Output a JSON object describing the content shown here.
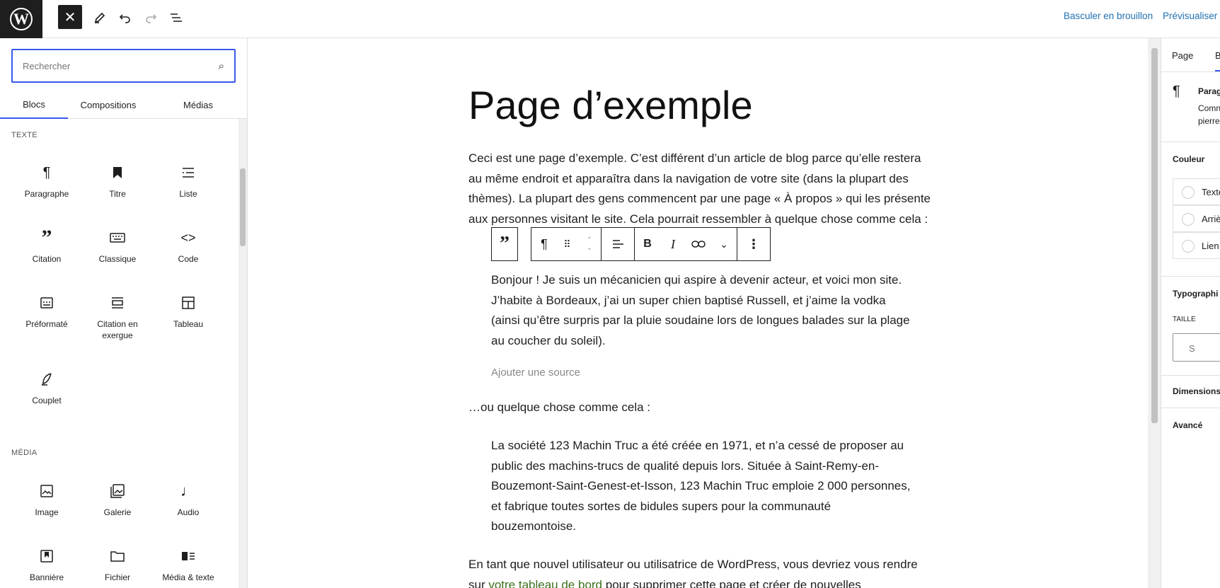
{
  "topbar": {
    "logo": "W",
    "right_links": [
      "Basculer en brouillon",
      "Prévisualiser"
    ]
  },
  "inserter": {
    "search_placeholder": "Rechercher",
    "tabs": [
      "Blocs",
      "Compositions",
      "Médias"
    ],
    "categories": {
      "text": "TEXTE",
      "media": "MÉDIA"
    },
    "text_blocks": [
      {
        "label": "Paragraphe",
        "icon": "paragraph-icon"
      },
      {
        "label": "Titre",
        "icon": "heading-icon"
      },
      {
        "label": "Liste",
        "icon": "list-icon"
      },
      {
        "label": "Citation",
        "icon": "quote-icon"
      },
      {
        "label": "Classique",
        "icon": "keyboard-icon"
      },
      {
        "label": "Code",
        "icon": "code-icon"
      },
      {
        "label": "Préformaté",
        "icon": "preformatted-icon"
      },
      {
        "label": "Citation en exergue",
        "icon": "pullquote-icon"
      },
      {
        "label": "Tableau",
        "icon": "table-icon"
      },
      {
        "label": "Couplet",
        "icon": "verse-icon"
      }
    ],
    "media_blocks": [
      {
        "label": "Image",
        "icon": "image-icon"
      },
      {
        "label": "Galerie",
        "icon": "gallery-icon"
      },
      {
        "label": "Audio",
        "icon": "audio-icon"
      },
      {
        "label": "Bannière",
        "icon": "cover-icon"
      },
      {
        "label": "Fichier",
        "icon": "file-icon"
      },
      {
        "label": "Média & texte",
        "icon": "media-text-icon"
      }
    ]
  },
  "document": {
    "title": "Page d’exemple",
    "intro": "Ceci est une page d’exemple. C’est différent d’un article de blog parce qu’elle restera au même endroit et apparaîtra dans la navigation de votre site (dans la plupart des thèmes). La plupart des gens commencent par une page « À propos » qui les présente aux personnes visitant le site. Cela pourrait ressembler à quelque chose comme cela :",
    "quote1": "Bonjour ! Je suis un mécanicien qui aspire à devenir acteur, et voici mon site. J’habite à Bordeaux, j’ai un super chien baptisé Russell, et j’aime la vodka (ainsi qu’être surpris par la pluie soudaine lors de longues balades sur la plage au coucher du soleil).",
    "cite_placeholder": "Ajouter une source",
    "between": "…ou quelque chose comme cela :",
    "quote2": "La société 123 Machin Truc a été créée en 1971, et n’a cessé de proposer au public des machins-trucs de qualité depuis lors. Située à Saint-Remy-en-Bouzemont-Saint-Genest-et-Isson, 123 Machin Truc emploie 2 000 personnes, et fabrique toutes sortes de bidules supers pour la communauté bouzemontoise.",
    "outro_before": "En tant que nouvel utilisateur ou utilisatrice de WordPress, vous devriez vous rendre sur ",
    "outro_link": "votre tableau de bord",
    "outro_after": " pour supprimer cette page et créer de nouvelles"
  },
  "sidebar": {
    "tabs": [
      "Page",
      "B"
    ],
    "block_name": "Parag",
    "block_desc": [
      "Comn",
      "pierre"
    ],
    "color_heading": "Couleur",
    "color_rows": [
      "Texte",
      "Arriè",
      "Lien"
    ],
    "typo_heading": "Typographi",
    "size_label": "TAILLE",
    "size_value": "S",
    "dimensions": "Dimensions",
    "advanced": "Avancé"
  }
}
